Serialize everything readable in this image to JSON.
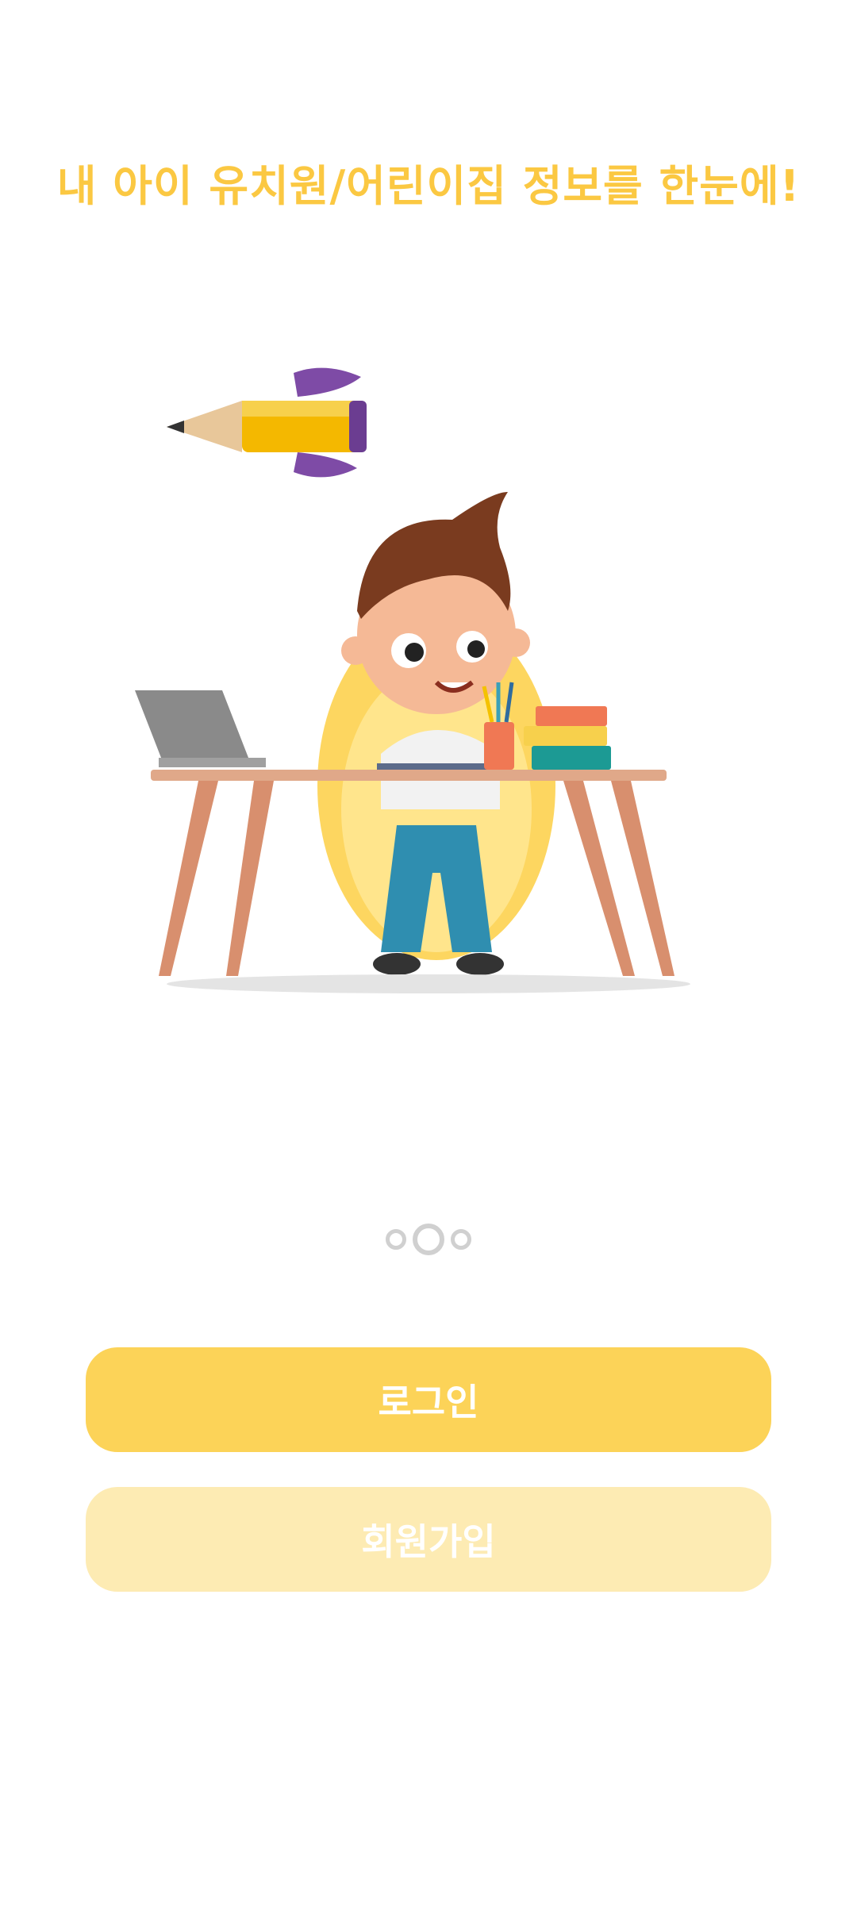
{
  "headline": "내 아이 유치원/어린이집 정보를 한눈에!",
  "pager": {
    "page_count": 3,
    "active_index": 1
  },
  "buttons": {
    "login_label": "로그인",
    "signup_label": "회원가입"
  },
  "colors": {
    "accent": "#FBC842",
    "primary_button": "#FCD358",
    "secondary_button": "#FDEBB3",
    "background": "#FFFFFF"
  },
  "illustration": {
    "subject": "boy studying at desk with laptop, pencil cup, books, and flying pencil rocket"
  }
}
